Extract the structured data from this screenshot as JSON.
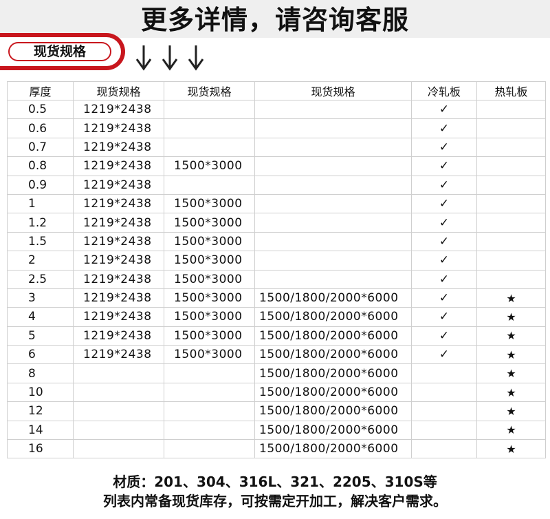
{
  "header": {
    "headline": "更多详情，请咨询客服"
  },
  "badge": {
    "label": "现货规格"
  },
  "table": {
    "columns": [
      "厚度",
      "现货规格",
      "现货规格",
      "现货规格",
      "冷轧板",
      "热轧板"
    ],
    "rows": [
      {
        "t": "0.5",
        "a": "1219*2438",
        "b": "",
        "c": "",
        "cold": "✓",
        "hot": ""
      },
      {
        "t": "0.6",
        "a": "1219*2438",
        "b": "",
        "c": "",
        "cold": "✓",
        "hot": ""
      },
      {
        "t": "0.7",
        "a": "1219*2438",
        "b": "",
        "c": "",
        "cold": "✓",
        "hot": ""
      },
      {
        "t": "0.8",
        "a": "1219*2438",
        "b": "1500*3000",
        "c": "",
        "cold": "✓",
        "hot": ""
      },
      {
        "t": "0.9",
        "a": "1219*2438",
        "b": "",
        "c": "",
        "cold": "✓",
        "hot": ""
      },
      {
        "t": "1",
        "a": "1219*2438",
        "b": "1500*3000",
        "c": "",
        "cold": "✓",
        "hot": ""
      },
      {
        "t": "1.2",
        "a": "1219*2438",
        "b": "1500*3000",
        "c": "",
        "cold": "✓",
        "hot": ""
      },
      {
        "t": "1.5",
        "a": "1219*2438",
        "b": "1500*3000",
        "c": "",
        "cold": "✓",
        "hot": ""
      },
      {
        "t": "2",
        "a": "1219*2438",
        "b": "1500*3000",
        "c": "",
        "cold": "✓",
        "hot": ""
      },
      {
        "t": "2.5",
        "a": "1219*2438",
        "b": "1500*3000",
        "c": "",
        "cold": "✓",
        "hot": ""
      },
      {
        "t": "3",
        "a": "1219*2438",
        "b": "1500*3000",
        "c": "1500/1800/2000*6000",
        "cold": "✓",
        "hot": "★"
      },
      {
        "t": "4",
        "a": "1219*2438",
        "b": "1500*3000",
        "c": "1500/1800/2000*6000",
        "cold": "✓",
        "hot": "★"
      },
      {
        "t": "5",
        "a": "1219*2438",
        "b": "1500*3000",
        "c": "1500/1800/2000*6000",
        "cold": "✓",
        "hot": "★"
      },
      {
        "t": "6",
        "a": "1219*2438",
        "b": "1500*3000",
        "c": "1500/1800/2000*6000",
        "cold": "✓",
        "hot": "★"
      },
      {
        "t": "8",
        "a": "",
        "b": "",
        "c": "1500/1800/2000*6000",
        "cold": "",
        "hot": "★"
      },
      {
        "t": "10",
        "a": "",
        "b": "",
        "c": "1500/1800/2000*6000",
        "cold": "",
        "hot": "★"
      },
      {
        "t": "12",
        "a": "",
        "b": "",
        "c": "1500/1800/2000*6000",
        "cold": "",
        "hot": "★"
      },
      {
        "t": "14",
        "a": "",
        "b": "",
        "c": "1500/1800/2000*6000",
        "cold": "",
        "hot": "★"
      },
      {
        "t": "16",
        "a": "",
        "b": "",
        "c": "1500/1800/2000*6000",
        "cold": "",
        "hot": "★"
      }
    ]
  },
  "footer": {
    "line1": "材质：201、304、316L、321、2205、310S等",
    "line2": "列表内常备现货库存，可按需定开加工，解决客户需求。"
  },
  "colors": {
    "accent": "#c8161d",
    "band": "#efefef",
    "grid": "#cfcfcf"
  },
  "icons": [
    "down-arrow-icon",
    "down-arrow-icon",
    "down-arrow-icon"
  ]
}
